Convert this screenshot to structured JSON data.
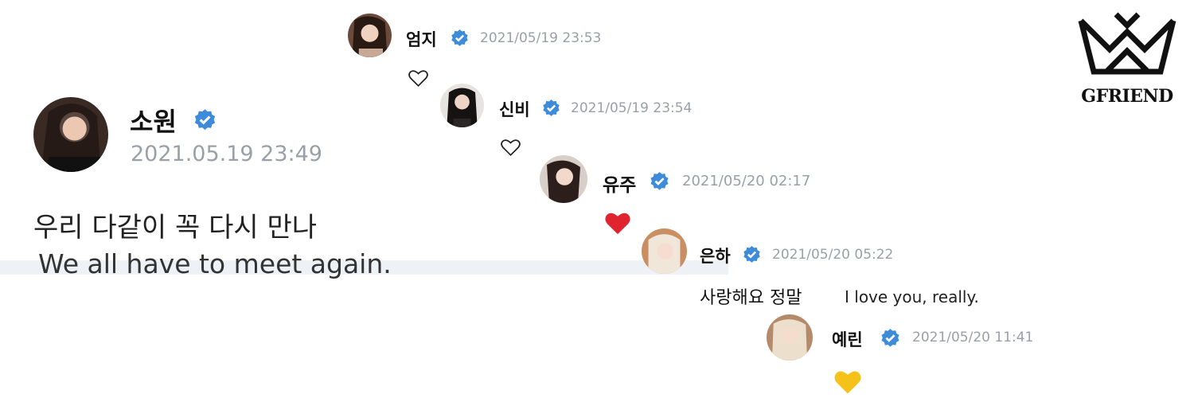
{
  "logo": {
    "text": "GFRIEND"
  },
  "main_post": {
    "author": "소원",
    "timestamp": "2021.05.19 23:49",
    "text_korean": "우리 다같이 꼭 다시 만나",
    "text_english": "We all have to meet again."
  },
  "replies": [
    {
      "author": "엄지",
      "timestamp": "2021/05/19 23:53",
      "reaction": "white-heart"
    },
    {
      "author": "신비",
      "timestamp": "2021/05/19 23:54",
      "reaction": "white-heart"
    },
    {
      "author": "유주",
      "timestamp": "2021/05/20 02:17",
      "reaction": "red-heart"
    },
    {
      "author": "은하",
      "timestamp": "2021/05/20 05:22",
      "text_korean": "사랑해요 정말",
      "text_english": "I love you, really."
    },
    {
      "author": "예린",
      "timestamp": "2021/05/20 11:41",
      "reaction": "yellow-heart"
    }
  ],
  "colors": {
    "verified_badge": "#3d8bd9",
    "timestamp": "#9aa0a8",
    "red_heart": "#e0242f",
    "yellow_heart": "#f5c21a"
  }
}
